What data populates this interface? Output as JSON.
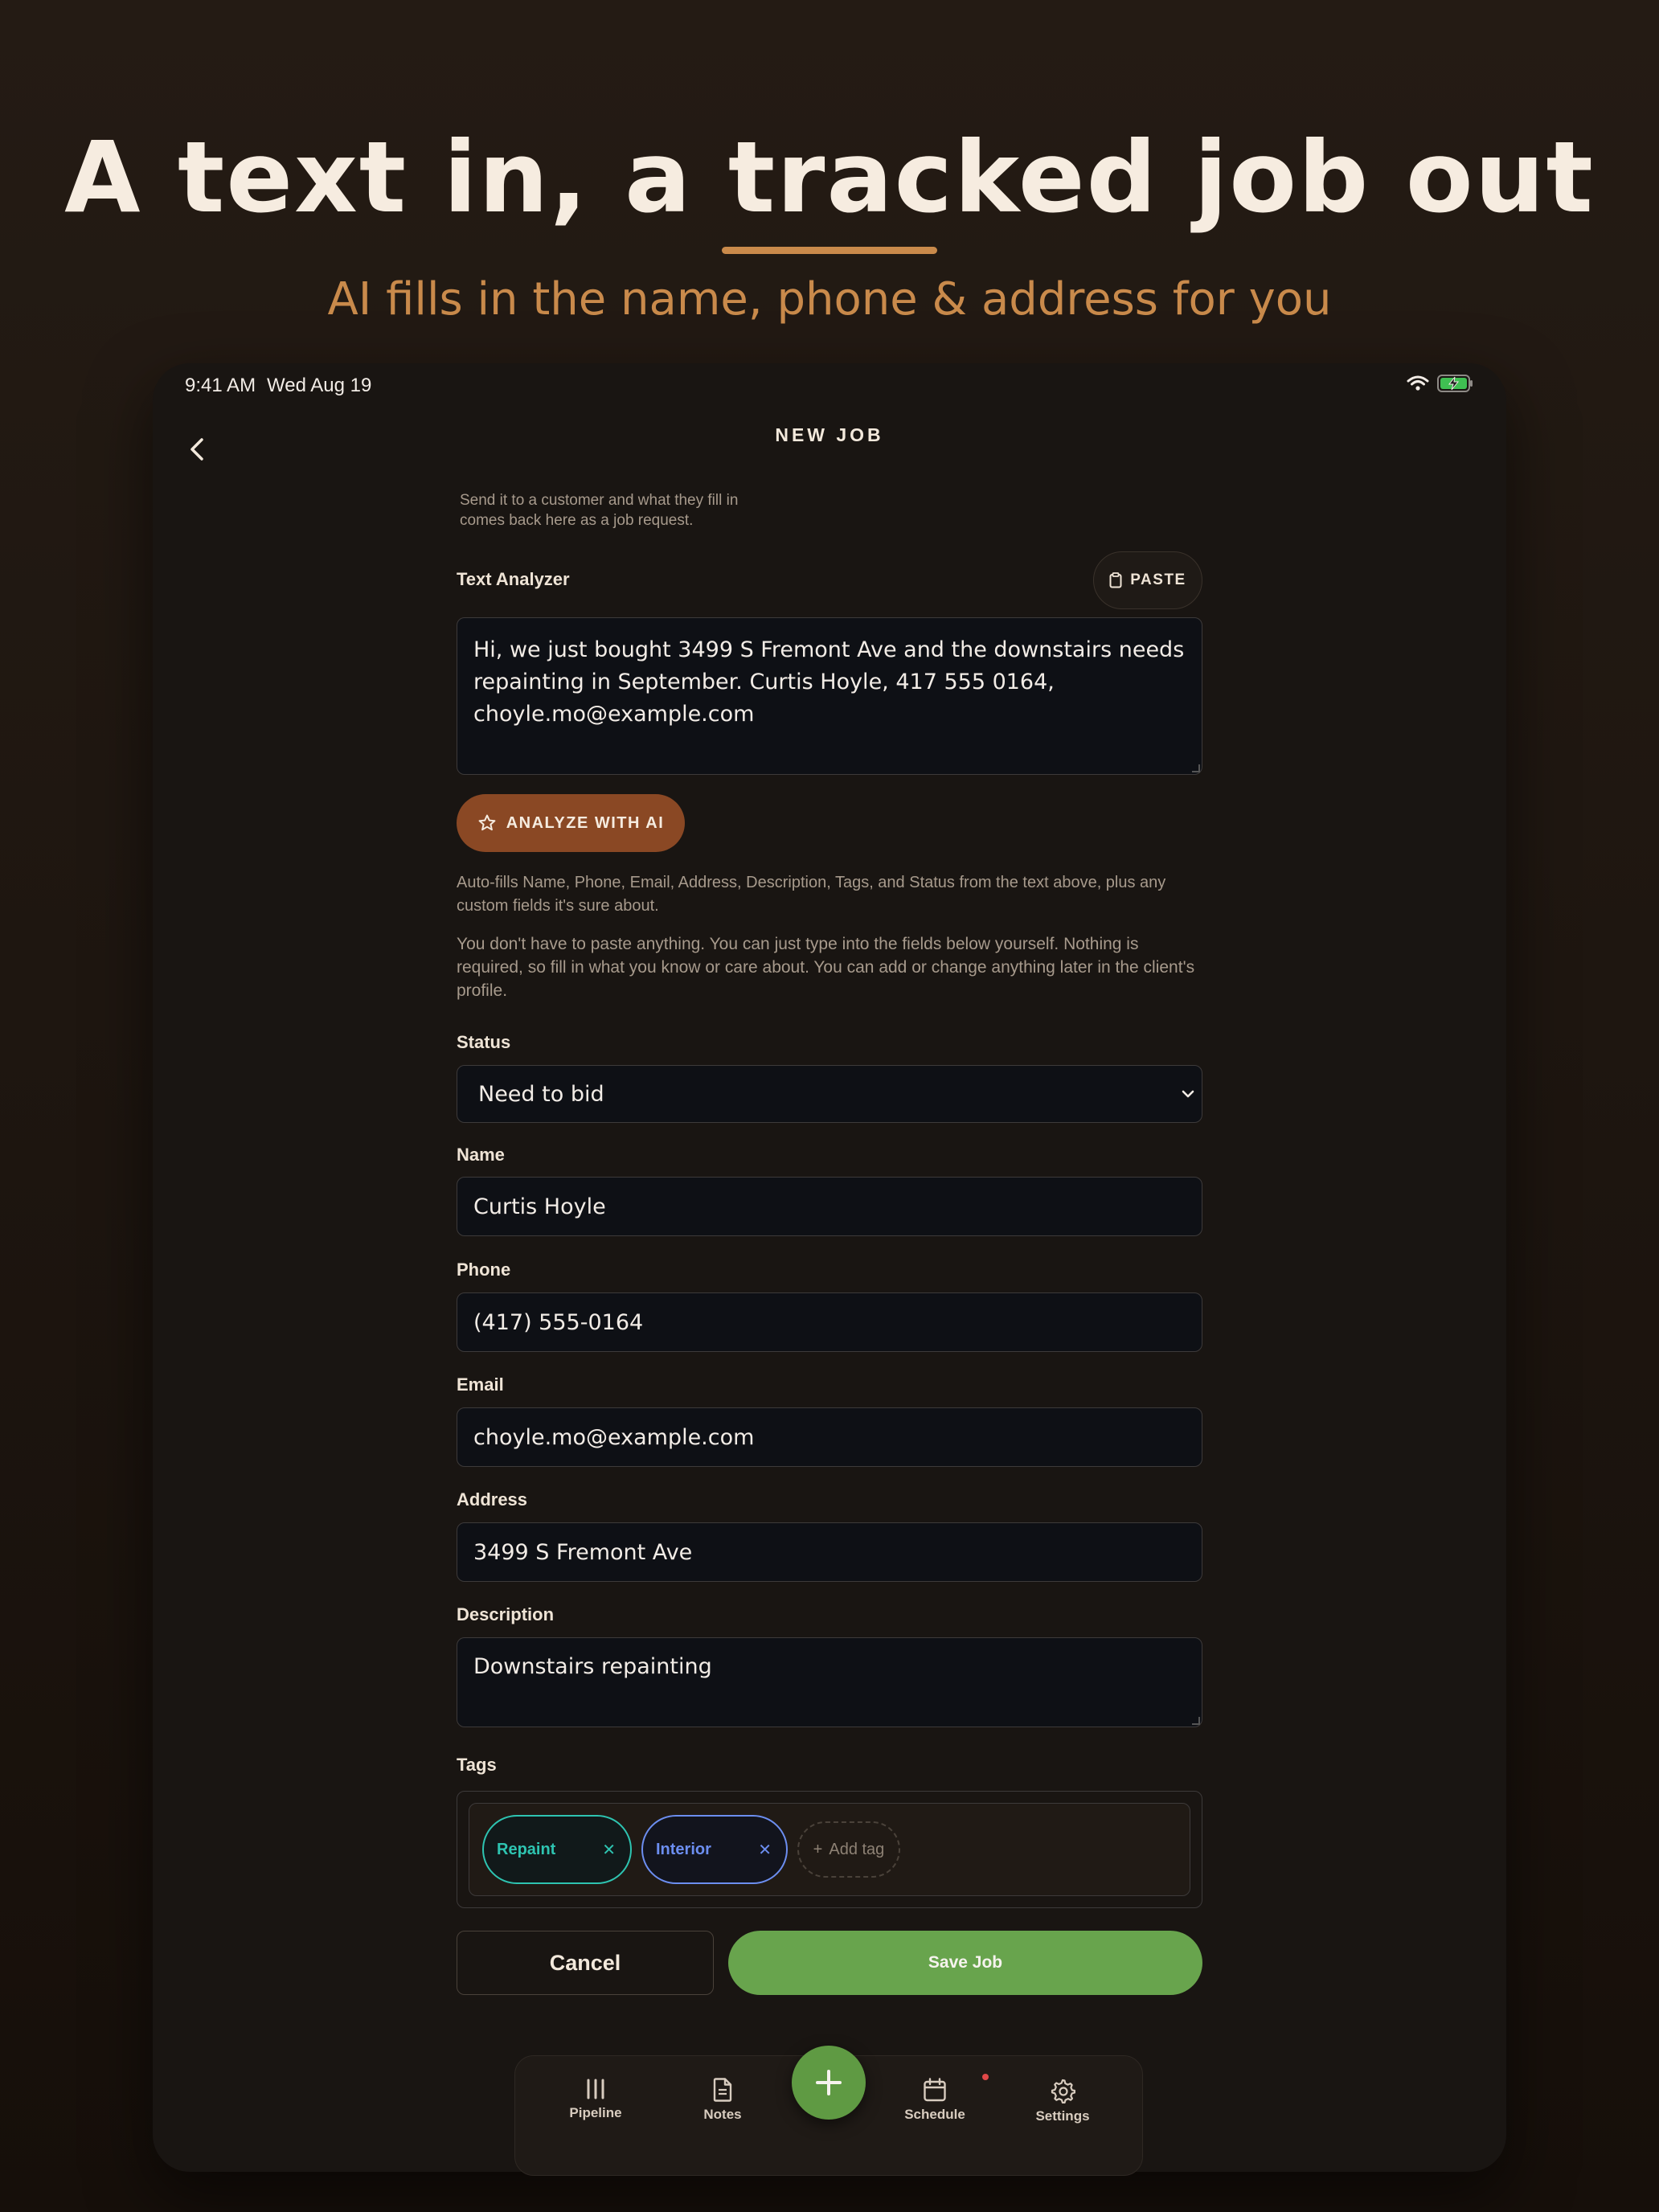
{
  "hero": {
    "title": "A text in, a tracked job out",
    "subtitle": "AI fills in the name, phone & address for you"
  },
  "status_bar": {
    "time": "9:41 AM",
    "date": "Wed Aug 19"
  },
  "header": {
    "title": "NEW JOB"
  },
  "intro_note": "Send it to a customer and what they fill in comes back here as a job request.",
  "text_analyzer": {
    "label": "Text Analyzer",
    "paste_label": "PASTE",
    "value": "Hi, we just bought 3499 S Fremont Ave and the downstairs needs repainting in September. Curtis Hoyle, 417 555 0164, choyle.mo@example.com",
    "analyze_label": "ANALYZE WITH AI",
    "helper": "Auto-fills Name, Phone, Email, Address, Description, Tags, and Status from the text above, plus any custom fields it's sure about."
  },
  "manual_note": "You don't have to paste anything. You can just type into the fields below yourself. Nothing is required, so fill in what you know or care about. You can add or change anything later in the client's profile.",
  "form": {
    "status": {
      "label": "Status",
      "value": "Need to bid"
    },
    "name": {
      "label": "Name",
      "value": "Curtis Hoyle"
    },
    "phone": {
      "label": "Phone",
      "value": "(417) 555-0164"
    },
    "email": {
      "label": "Email",
      "value": "choyle.mo@example.com"
    },
    "address": {
      "label": "Address",
      "value": "3499 S Fremont Ave"
    },
    "description": {
      "label": "Description",
      "value": "Downstairs repainting"
    },
    "tags": {
      "label": "Tags",
      "items": [
        {
          "label": "Repaint",
          "color": "#2ec4b1"
        },
        {
          "label": "Interior",
          "color": "#6c8ef0"
        }
      ],
      "add_label": "Add tag"
    }
  },
  "actions": {
    "cancel_label": "Cancel",
    "save_label": "Save Job"
  },
  "tab_bar": {
    "items": [
      {
        "label": "Pipeline",
        "icon": "pipeline-icon"
      },
      {
        "label": "Notes",
        "icon": "notes-icon"
      },
      {
        "label": "Schedule",
        "icon": "calendar-icon"
      },
      {
        "label": "Settings",
        "icon": "gear-icon"
      }
    ]
  },
  "colors": {
    "accent": "#c98a4b",
    "ai_button": "#8a4824",
    "save_button": "#68a44d"
  }
}
